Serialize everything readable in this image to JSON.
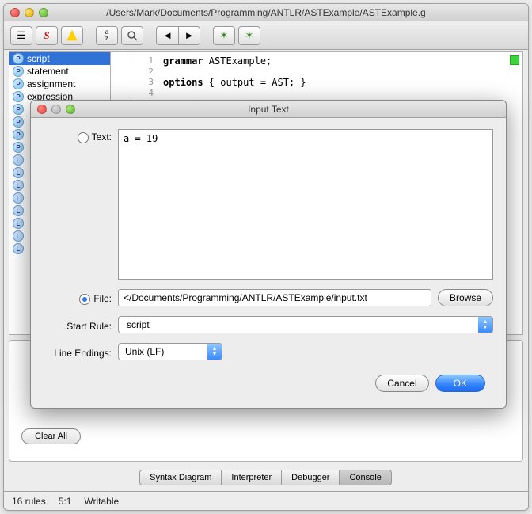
{
  "window": {
    "title": "/Users/Mark/Documents/Programming/ANTLR/ASTExample/ASTExample.g"
  },
  "sidebar": {
    "items": [
      {
        "badge": "P",
        "label": "script",
        "selected": true
      },
      {
        "badge": "P",
        "label": "statement",
        "selected": false
      },
      {
        "badge": "P",
        "label": "assignment",
        "selected": false
      },
      {
        "badge": "P",
        "label": "expression",
        "selected": false
      },
      {
        "badge": "P",
        "label": "",
        "selected": false
      },
      {
        "badge": "P",
        "label": "",
        "selected": false
      },
      {
        "badge": "P",
        "label": "",
        "selected": false
      },
      {
        "badge": "P",
        "label": "",
        "selected": false
      },
      {
        "badge": "L",
        "label": "",
        "selected": false
      },
      {
        "badge": "L",
        "label": "",
        "selected": false
      },
      {
        "badge": "L",
        "label": "",
        "selected": false
      },
      {
        "badge": "L",
        "label": "",
        "selected": false
      },
      {
        "badge": "L",
        "label": "",
        "selected": false
      },
      {
        "badge": "L",
        "label": "",
        "selected": false
      },
      {
        "badge": "L",
        "label": "",
        "selected": false
      },
      {
        "badge": "L",
        "label": "",
        "selected": false
      }
    ]
  },
  "editor": {
    "lines": [
      "grammar ASTExample;",
      "",
      "options { output = AST; }",
      ""
    ]
  },
  "dialog": {
    "title": "Input Text",
    "radio_text_label": "Text:",
    "radio_file_label": "File:",
    "text_value": "a = 19",
    "file_value": "</Documents/Programming/ANTLR/ASTExample/input.txt",
    "browse_label": "Browse",
    "start_rule_label": "Start Rule:",
    "start_rule_value": "script",
    "line_endings_label": "Line Endings:",
    "line_endings_value": "Unix (LF)",
    "cancel_label": "Cancel",
    "ok_label": "OK"
  },
  "lower": {
    "clear_all": "Clear All"
  },
  "tabs": [
    {
      "label": "Syntax Diagram",
      "active": false
    },
    {
      "label": "Interpreter",
      "active": false
    },
    {
      "label": "Debugger",
      "active": false
    },
    {
      "label": "Console",
      "active": true
    }
  ],
  "status": {
    "rules": "16 rules",
    "pos": "5:1",
    "mode": "Writable"
  },
  "toolbar": {
    "sort_icon": "a/z",
    "magnifier_icon": "search"
  }
}
